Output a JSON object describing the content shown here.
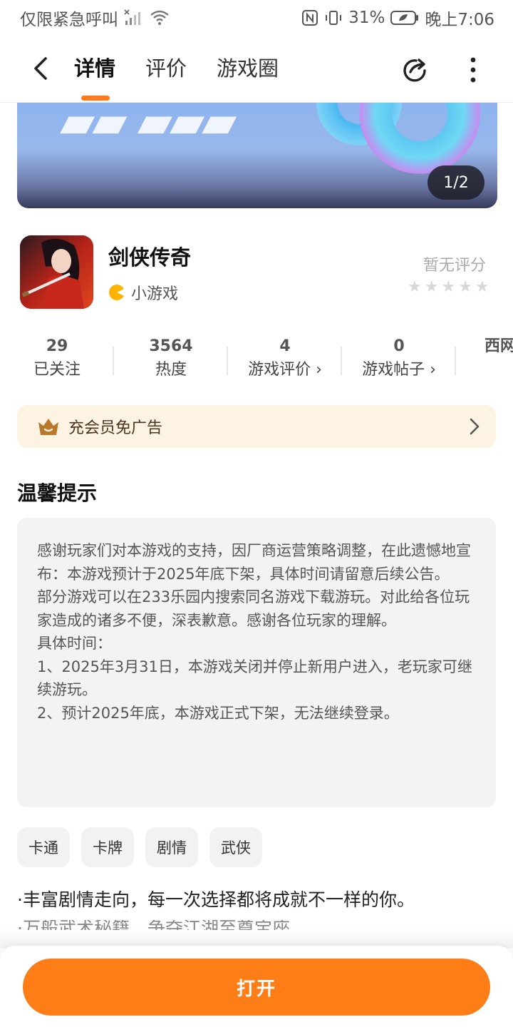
{
  "status_bar": {
    "carrier": "仅限紧急呼叫",
    "battery": "31%",
    "time": "晚上7:06"
  },
  "nav": {
    "tabs": [
      {
        "label": "详情",
        "active": true
      },
      {
        "label": "评价",
        "active": false
      },
      {
        "label": "游戏圈",
        "active": false
      }
    ]
  },
  "banner": {
    "pager": "1/2"
  },
  "game": {
    "name": "剑侠传奇",
    "category": "小游戏",
    "rating_text": "暂无评分",
    "stars": [
      "★",
      "★",
      "★",
      "★",
      "★"
    ]
  },
  "stats": [
    {
      "value": "29",
      "label": "已关注"
    },
    {
      "value": "3564",
      "label": "热度"
    },
    {
      "value": "4",
      "label": "游戏评价 ›"
    },
    {
      "value": "0",
      "label": "游戏帖子 ›"
    },
    {
      "value": "西网",
      "label": ""
    }
  ],
  "member_banner": {
    "label": "充会员免广告"
  },
  "tip": {
    "title": "温馨提示",
    "lines": [
      "感谢玩家们对本游戏的支持，因厂商运营策略调整，在此遗憾地宣布：本游戏预计于2025年底下架，具体时间请留意后续公告。",
      "部分游戏可以在233乐园内搜索同名游戏下载游玩。对此给各位玩家造成的诸多不便，深表歉意。感谢各位玩家的理解。",
      "具体时间：",
      "1、2025年3月31日，本游戏关闭并停止新用户进入，老玩家可继续游玩。",
      "2、预计2025年底，本游戏正式下架，无法继续登录。"
    ]
  },
  "tags": [
    "卡通",
    "卡牌",
    "剧情",
    "武侠"
  ],
  "description": {
    "line1": "·丰富剧情走向，每一次选择都将成就不一样的你。",
    "line2": "·万般武术秘籍，争夺江湖至尊宝座"
  },
  "bottom": {
    "open_label": "打开"
  },
  "colors": {
    "accent": "#ff7d17",
    "member_bg": "#fdf3e3",
    "tip_bg": "#f3f3f3"
  }
}
